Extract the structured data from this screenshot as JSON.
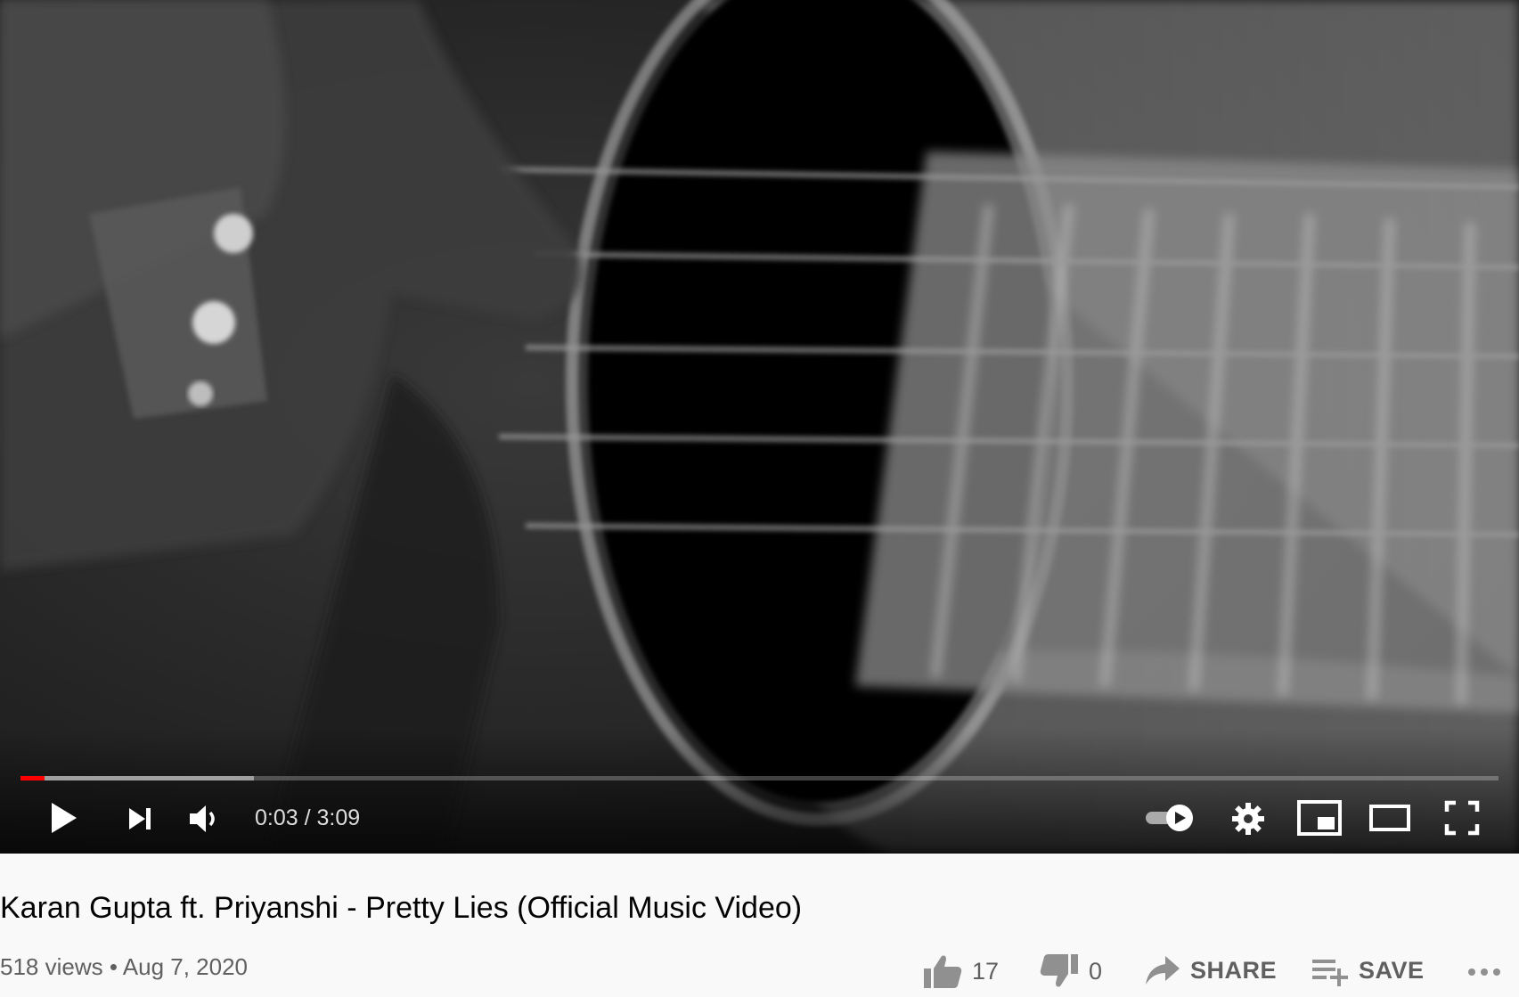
{
  "player": {
    "time_current": "0:03",
    "time_separator": "/",
    "time_total": "3:09",
    "played_fraction": 0.016,
    "loaded_fraction": 0.158,
    "progress_color": "#ff0000"
  },
  "video": {
    "title": "Karan Gupta ft. Priyanshi - Pretty Lies (Official Music Video)",
    "views": "518 views",
    "separator": "•",
    "date": "Aug 7, 2020"
  },
  "actions": {
    "like_count": "17",
    "dislike_count": "0",
    "share_label": "SHARE",
    "save_label": "SAVE",
    "more_label": "..."
  },
  "icons": [
    "play-icon",
    "next-icon",
    "volume-icon",
    "autoplay-toggle-icon",
    "settings-icon",
    "miniplayer-icon",
    "theater-icon",
    "fullscreen-icon",
    "thumb-up-icon",
    "thumb-down-icon",
    "share-icon",
    "save-playlist-icon",
    "more-icon"
  ]
}
